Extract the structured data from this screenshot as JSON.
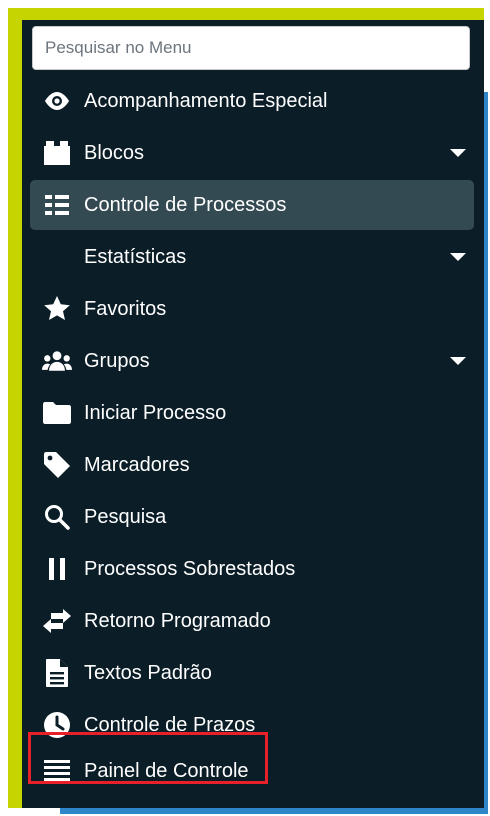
{
  "search": {
    "placeholder": "Pesquisar no Menu"
  },
  "colors": {
    "panel": "#0b1d26",
    "active": "#344a52",
    "frame_green": "#c6d400",
    "frame_blue": "#2e86c9",
    "highlight": "#e8202a"
  },
  "menu": {
    "items": [
      {
        "label": "Acompanhamento Especial",
        "icon": "eye-icon"
      },
      {
        "label": "Blocos",
        "icon": "blocks-icon",
        "has_submenu": true
      },
      {
        "label": "Controle de Processos",
        "icon": "list-icon",
        "active": true
      },
      {
        "label": "Estatísticas",
        "icon": "",
        "has_submenu": true
      },
      {
        "label": "Favoritos",
        "icon": "star-icon"
      },
      {
        "label": "Grupos",
        "icon": "users-icon",
        "has_submenu": true
      },
      {
        "label": "Iniciar Processo",
        "icon": "folder-icon"
      },
      {
        "label": "Marcadores",
        "icon": "tag-icon"
      },
      {
        "label": "Pesquisa",
        "icon": "search-icon"
      },
      {
        "label": "Processos Sobrestados",
        "icon": "pause-icon"
      },
      {
        "label": "Retorno Programado",
        "icon": "exchange-icon"
      },
      {
        "label": "Textos Padrão",
        "icon": "document-icon"
      },
      {
        "label": "Controle de Prazos",
        "icon": "clock-icon"
      },
      {
        "label": "Painel de Controle",
        "icon": "bars-icon",
        "highlighted": true
      }
    ]
  }
}
